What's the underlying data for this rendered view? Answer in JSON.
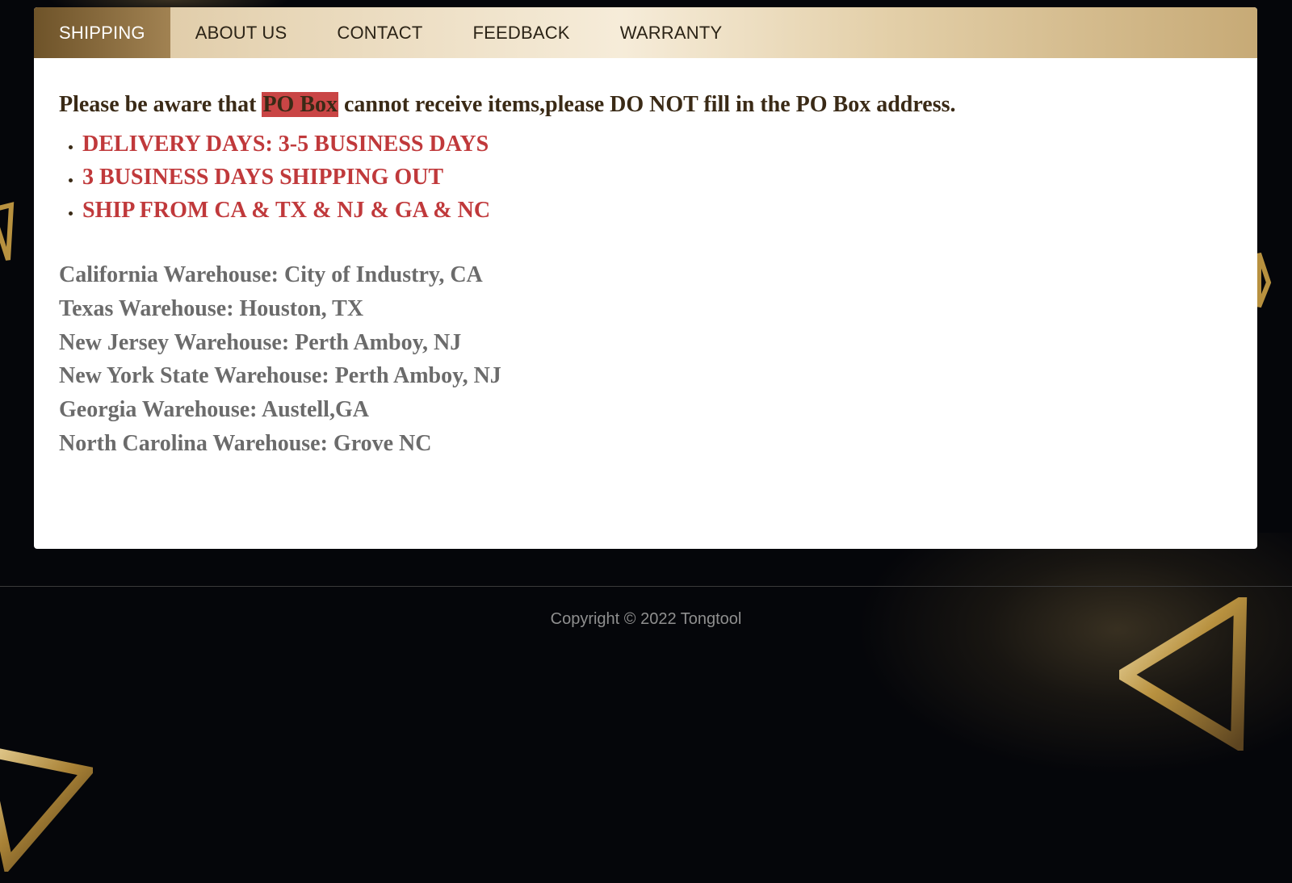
{
  "nav": {
    "tabs": [
      {
        "label": "SHIPPING",
        "active": true
      },
      {
        "label": "ABOUT US",
        "active": false
      },
      {
        "label": "CONTACT",
        "active": false
      },
      {
        "label": "FEEDBACK",
        "active": false
      },
      {
        "label": "WARRANTY",
        "active": false
      }
    ]
  },
  "notice": {
    "prefix": "Please be aware that ",
    "highlight": "PO Box",
    "suffix": " cannot receive items,please DO NOT fill in the PO Box address."
  },
  "bullets": [
    "DELIVERY DAYS: 3-5 BUSINESS DAYS",
    "3 BUSINESS DAYS SHIPPING OUT",
    "SHIP FROM CA & TX & NJ & GA & NC"
  ],
  "warehouses": [
    "California Warehouse: City of Industry, CA",
    "Texas Warehouse: Houston, TX",
    "New Jersey Warehouse: Perth Amboy, NJ",
    "New York State Warehouse: Perth Amboy, NJ",
    "Georgia Warehouse: Austell,GA",
    "North Carolina Warehouse: Grove NC"
  ],
  "footer": {
    "copyright": "Copyright © 2022 Tongtool"
  },
  "colors": {
    "accent_red": "#c0393b",
    "highlight_bg": "#c94545",
    "nav_active": "#6e5329",
    "gold": "#c7aa76",
    "background": "#05060a"
  },
  "icons": {
    "decoration": "gold-triangle-icon"
  }
}
